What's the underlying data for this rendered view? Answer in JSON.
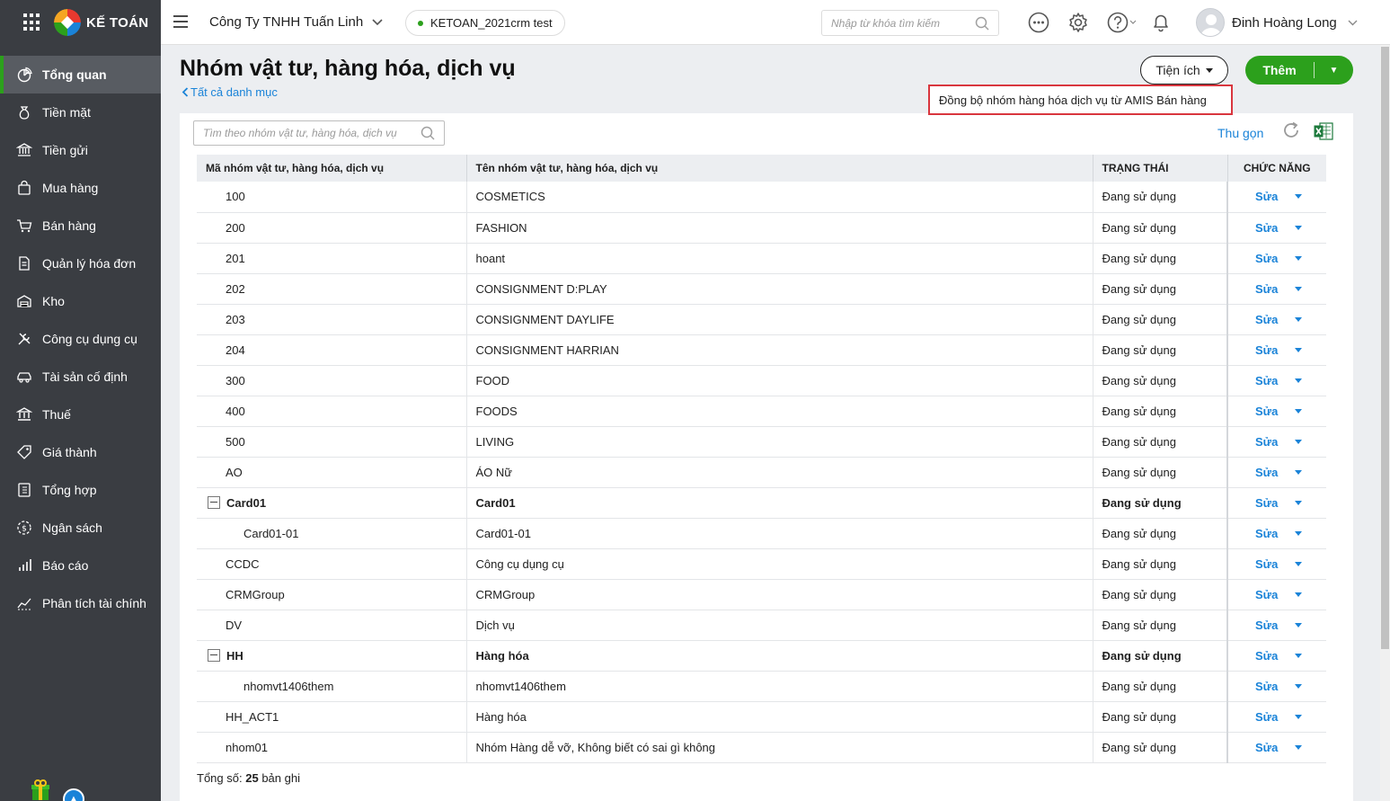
{
  "app": {
    "logo_text": "KẾ TOÁN"
  },
  "sidebar": {
    "items": [
      {
        "label": "Tổng quan",
        "icon": "dashboard-icon"
      },
      {
        "label": "Tiền mặt",
        "icon": "cash-bag-icon"
      },
      {
        "label": "Tiền gửi",
        "icon": "bank-icon"
      },
      {
        "label": "Mua hàng",
        "icon": "shopping-bag-icon"
      },
      {
        "label": "Bán hàng",
        "icon": "cart-icon"
      },
      {
        "label": "Quản lý hóa đơn",
        "icon": "invoice-icon"
      },
      {
        "label": "Kho",
        "icon": "warehouse-icon"
      },
      {
        "label": "Công cụ dụng cụ",
        "icon": "tools-icon"
      },
      {
        "label": "Tài sản cố định",
        "icon": "car-asset-icon"
      },
      {
        "label": "Thuế",
        "icon": "tax-building-icon"
      },
      {
        "label": "Giá thành",
        "icon": "price-tag-icon"
      },
      {
        "label": "Tổng hợp",
        "icon": "ledger-icon"
      },
      {
        "label": "Ngân sách",
        "icon": "budget-coin-icon"
      },
      {
        "label": "Báo cáo",
        "icon": "bar-report-icon"
      },
      {
        "label": "Phân tích tài chính",
        "icon": "line-chart-icon"
      }
    ]
  },
  "topbar": {
    "company": "Công Ty TNHH Tuấn Linh",
    "database": "KETOAN_2021crm test",
    "search_placeholder": "Nhập từ khóa tìm kiếm",
    "user_name": "Đinh Hoàng Long"
  },
  "page": {
    "title": "Nhóm vật tư, hàng hóa, dịch vụ",
    "back_link": "Tất cả danh mục",
    "utility_label": "Tiện ích",
    "add_label": "Thêm",
    "sync_menu_item": "Đồng bộ nhóm hàng hóa dịch vụ từ AMIS Bán hàng",
    "filter_placeholder": "Tìm theo nhóm vật tư, hàng hóa, dịch vụ",
    "collapse_label": "Thu gọn"
  },
  "table": {
    "headers": [
      "Mã nhóm vật tư, hàng hóa, dịch vụ",
      "Tên nhóm vật tư, hàng hóa, dịch vụ",
      "TRẠNG THÁI",
      "CHỨC NĂNG"
    ],
    "edit_label": "Sửa",
    "rows": [
      {
        "code": "100",
        "name": "COSMETICS",
        "status": "Đang sử dụng",
        "level": 0,
        "parent": false
      },
      {
        "code": "200",
        "name": "FASHION",
        "status": "Đang sử dụng",
        "level": 0,
        "parent": false
      },
      {
        "code": "201",
        "name": "hoant",
        "status": "Đang sử dụng",
        "level": 0,
        "parent": false
      },
      {
        "code": "202",
        "name": "CONSIGNMENT D:PLAY",
        "status": "Đang sử dụng",
        "level": 0,
        "parent": false
      },
      {
        "code": "203",
        "name": "CONSIGNMENT DAYLIFE",
        "status": "Đang sử dụng",
        "level": 0,
        "parent": false
      },
      {
        "code": "204",
        "name": "CONSIGNMENT HARRIAN",
        "status": "Đang sử dụng",
        "level": 0,
        "parent": false
      },
      {
        "code": "300",
        "name": "FOOD",
        "status": "Đang sử dụng",
        "level": 0,
        "parent": false
      },
      {
        "code": "400",
        "name": "FOODS",
        "status": "Đang sử dụng",
        "level": 0,
        "parent": false
      },
      {
        "code": "500",
        "name": "LIVING",
        "status": "Đang sử dụng",
        "level": 0,
        "parent": false
      },
      {
        "code": "AO",
        "name": "ÁO Nữ",
        "status": "Đang sử dụng",
        "level": 0,
        "parent": false
      },
      {
        "code": "Card01",
        "name": "Card01",
        "status": "Đang sử dụng",
        "level": 0,
        "parent": true
      },
      {
        "code": "Card01-01",
        "name": "Card01-01",
        "status": "Đang sử dụng",
        "level": 1,
        "parent": false
      },
      {
        "code": "CCDC",
        "name": "Công cụ dụng cụ",
        "status": "Đang sử dụng",
        "level": 0,
        "parent": false
      },
      {
        "code": "CRMGroup",
        "name": "CRMGroup",
        "status": "Đang sử dụng",
        "level": 0,
        "parent": false
      },
      {
        "code": "DV",
        "name": "Dịch vụ",
        "status": "Đang sử dụng",
        "level": 0,
        "parent": false
      },
      {
        "code": "HH",
        "name": "Hàng hóa",
        "status": "Đang sử dụng",
        "level": 0,
        "parent": true
      },
      {
        "code": "nhomvt1406them",
        "name": "nhomvt1406them",
        "status": "Đang sử dụng",
        "level": 1,
        "parent": false
      },
      {
        "code": "HH_ACT1",
        "name": "Hàng hóa",
        "status": "Đang sử dụng",
        "level": 0,
        "parent": false
      },
      {
        "code": "nhom01",
        "name": "Nhóm Hàng dễ vỡ, Không biết có sai gì không",
        "status": "Đang sử dụng",
        "level": 0,
        "parent": false
      }
    ],
    "total_prefix": "Tổng số:",
    "total_count": "25",
    "total_suffix": "bản ghi"
  },
  "colors": {
    "accent_green": "#2ca01c",
    "link_blue": "#1a83d8",
    "sidebar_bg": "#3a3d42",
    "highlight_red": "#d9363e"
  }
}
